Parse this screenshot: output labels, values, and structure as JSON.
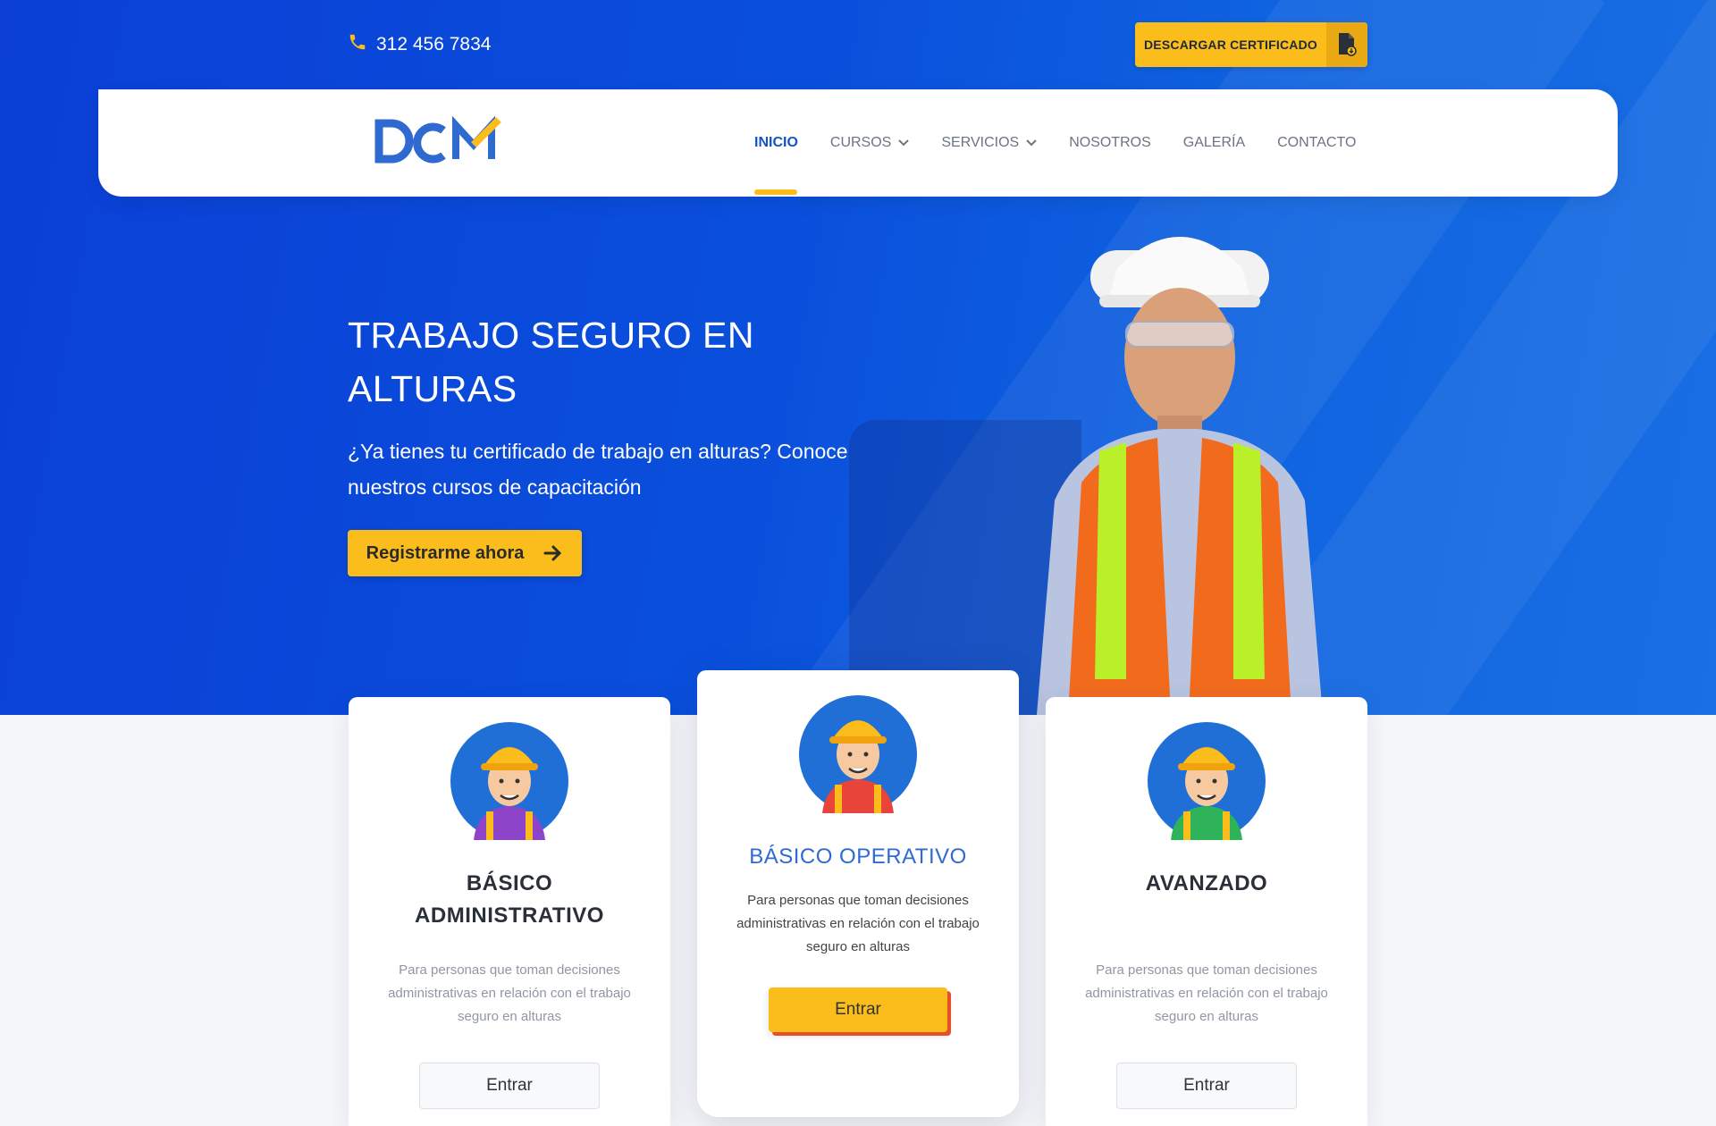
{
  "topbar": {
    "phone": "312 456 7834",
    "certificate_button": "DESCARGAR CERTIFICADO"
  },
  "logo": {
    "text": "DCM"
  },
  "nav": {
    "items": [
      {
        "label": "INICIO",
        "active": true,
        "dropdown": false
      },
      {
        "label": "CURSOS",
        "active": false,
        "dropdown": true
      },
      {
        "label": "SERVICIOS",
        "active": false,
        "dropdown": true
      },
      {
        "label": "NOSOTROS",
        "active": false,
        "dropdown": false
      },
      {
        "label": "GALERÍA",
        "active": false,
        "dropdown": false
      },
      {
        "label": "CONTACTO",
        "active": false,
        "dropdown": false
      }
    ]
  },
  "hero": {
    "title": "TRABAJO SEGURO EN ALTURAS",
    "subtitle": "¿Ya tienes tu certificado de trabajo en alturas? Conoce nuestros cursos de capacitación",
    "cta": "Registrarme ahora"
  },
  "cards": [
    {
      "title": "BÁSICO ADMINISTRATIVO",
      "description": "Para personas que toman decisiones administrativas en relación con el trabajo seguro en alturas",
      "button": "Entrar",
      "shirt_color": "#8e44c9"
    },
    {
      "title": "BÁSICO OPERATIVO",
      "description": "Para personas que toman decisiones administrativas en relación con el trabajo seguro en alturas",
      "button": "Entrar",
      "shirt_color": "#e8443a"
    },
    {
      "title": "AVANZADO",
      "description": "Para personas que toman decisiones administrativas en relación con el trabajo seguro en alturas",
      "button": "Entrar",
      "shirt_color": "#2fb35a"
    }
  ],
  "colors": {
    "accent": "#fbbd1b",
    "primary": "#1652c8",
    "hero_bg": "#0a4fdc"
  }
}
